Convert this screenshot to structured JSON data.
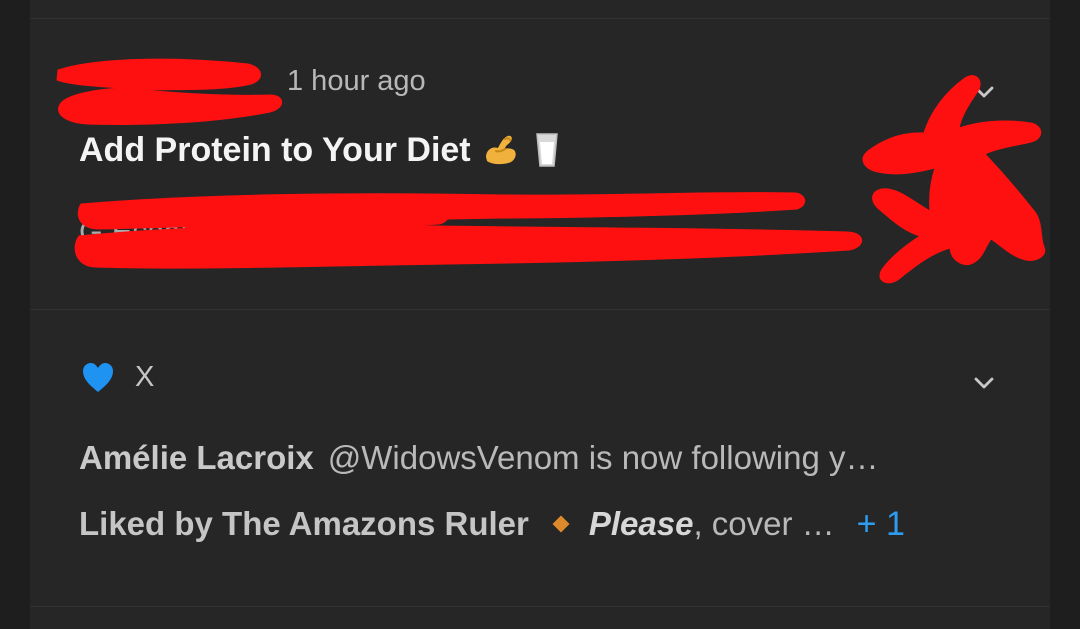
{
  "notifications": [
    {
      "time": "1 hour ago",
      "title": "Add Protein to Your Diet",
      "title_emoji_1": "flexed-biceps",
      "title_emoji_2": "glass-of-milk",
      "preview_visible": "G   Essential D                                       t 4"
    },
    {
      "app": "X",
      "line1_name": "Amélie Lacroix",
      "line1_text": "@WidowsVenom is now following y…",
      "line2_prefix": "Liked by The Amazons Ruler",
      "line2_emphasis": "Please",
      "line2_text": ", cover …",
      "line2_count": "+ 1",
      "icon": "blue-heart-icon"
    }
  ],
  "colors": {
    "background": "#1e1e1e",
    "panel": "#262626",
    "divider": "#323232",
    "primary_text": "#f4f4f4",
    "secondary_text": "#b9b9b9",
    "redaction": "#ff1010",
    "heart": "#1f93f2",
    "accent_diamond": "#dd8a2d",
    "count_blue": "#2e9df1"
  }
}
